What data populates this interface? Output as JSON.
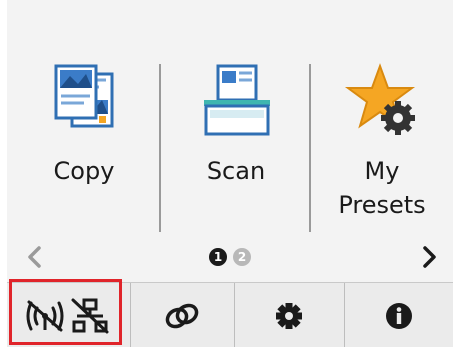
{
  "tiles": [
    {
      "label": "Copy",
      "icon": "copy-icon"
    },
    {
      "label": "Scan",
      "icon": "scan-icon"
    },
    {
      "label": "My\nPresets",
      "icon": "my-presets-icon"
    }
  ],
  "pager": {
    "prev_icon": "chevron-left-icon",
    "next_icon": "chevron-right-icon",
    "pages": [
      "1",
      "2"
    ],
    "current_page": 1
  },
  "bottom_bar": {
    "items": [
      {
        "icon": "wireless-off-icon"
      },
      {
        "icon": "wired-lan-off-icon"
      },
      {
        "icon": "link-icon"
      },
      {
        "icon": "gear-icon"
      },
      {
        "icon": "info-icon"
      }
    ]
  },
  "colors": {
    "highlight": "#e0242a",
    "star": "#f5a623",
    "accent_blue": "#2a8fd6",
    "accent_teal": "#3fb6b0"
  }
}
